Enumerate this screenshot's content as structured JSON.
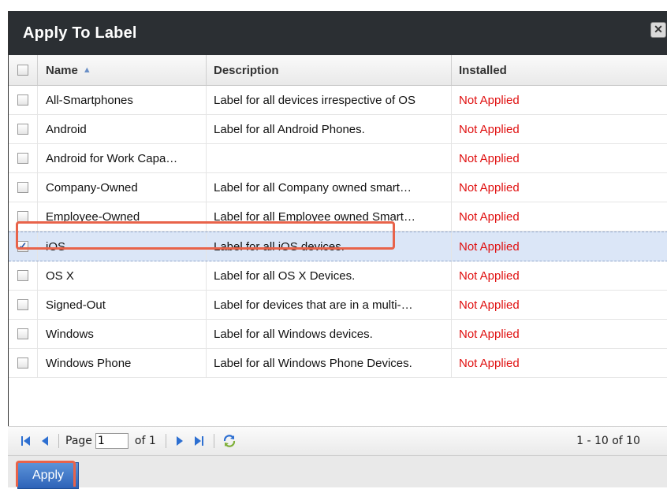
{
  "dialog": {
    "title": "Apply To Label",
    "close_icon": "close-icon"
  },
  "grid": {
    "columns": {
      "name": "Name",
      "description": "Description",
      "installed": "Installed"
    },
    "sort": {
      "column": "name",
      "direction": "ascending"
    },
    "rows": [
      {
        "checked": false,
        "name": "All-Smartphones",
        "description": "Label for all devices irrespective of OS",
        "installed": "Not Applied"
      },
      {
        "checked": false,
        "name": "Android",
        "description": "Label for all Android Phones.",
        "installed": "Not Applied"
      },
      {
        "checked": false,
        "name": "Android for Work Capa…",
        "description": "",
        "installed": "Not Applied"
      },
      {
        "checked": false,
        "name": "Company-Owned",
        "description": "Label for all Company owned smart…",
        "installed": "Not Applied"
      },
      {
        "checked": false,
        "name": "Employee-Owned",
        "description": "Label for all Employee owned Smart…",
        "installed": "Not Applied"
      },
      {
        "checked": true,
        "name": "iOS",
        "description": "Label for all iOS devices.",
        "installed": "Not Applied"
      },
      {
        "checked": false,
        "name": "OS X",
        "description": "Label for all OS X Devices.",
        "installed": "Not Applied"
      },
      {
        "checked": false,
        "name": "Signed-Out",
        "description": "Label for devices that are in a multi-…",
        "installed": "Not Applied"
      },
      {
        "checked": false,
        "name": "Windows",
        "description": "Label for all Windows devices.",
        "installed": "Not Applied"
      },
      {
        "checked": false,
        "name": "Windows Phone",
        "description": "Label for all Windows Phone Devices.",
        "installed": "Not Applied"
      }
    ]
  },
  "pager": {
    "page_label": "Page",
    "page_value": "1",
    "of_label": "of 1",
    "count_text": "1 - 10 of 10",
    "icons": [
      "first-page-icon",
      "prev-page-icon",
      "next-page-icon",
      "last-page-icon",
      "refresh-icon"
    ]
  },
  "footer": {
    "apply_label": "Apply"
  },
  "colors": {
    "titlebar": "#2b2f33",
    "status_red": "#e01010",
    "highlight": "#e8634a",
    "selected_row": "#dbe6f7",
    "pager_blue": "#2d6fd1"
  }
}
